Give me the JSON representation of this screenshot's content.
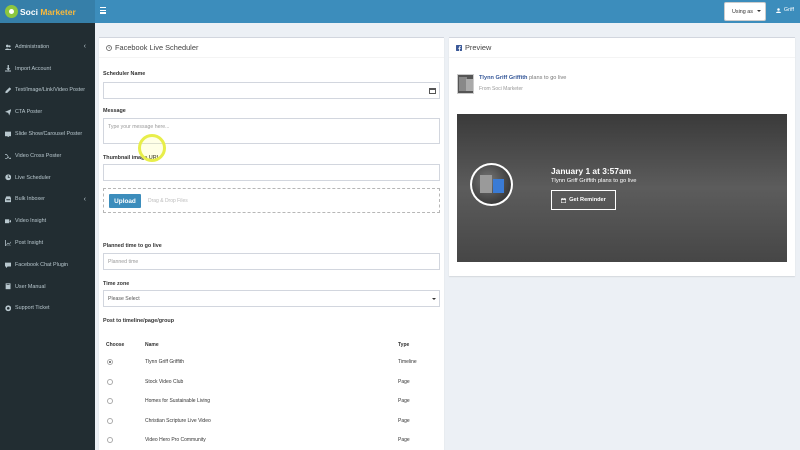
{
  "app": {
    "logo_main": "Soci",
    "logo_accent": "Marketer"
  },
  "header": {
    "using_as_label": "Using as",
    "user_name": "Griff"
  },
  "sidebar": {
    "items": [
      {
        "label": "Administration",
        "icon": "users-icon",
        "has_chevron": true
      },
      {
        "label": "Import Account",
        "icon": "import-icon",
        "has_chevron": false
      },
      {
        "label": "Text/Image/Link/Video Poster",
        "icon": "edit-icon",
        "has_chevron": false
      },
      {
        "label": "CTA Poster",
        "icon": "send-icon",
        "has_chevron": false
      },
      {
        "label": "Slide Show/Carousel Poster",
        "icon": "slideshow-icon",
        "has_chevron": false
      },
      {
        "label": "Video Cross Poster",
        "icon": "shuffle-icon",
        "has_chevron": false
      },
      {
        "label": "Live Scheduler",
        "icon": "clock-icon",
        "has_chevron": false
      },
      {
        "label": "Bulk Inboxer",
        "icon": "inbox-icon",
        "has_chevron": true
      },
      {
        "label": "Video Insight",
        "icon": "video-icon",
        "has_chevron": false
      },
      {
        "label": "Post Insight",
        "icon": "chart-icon",
        "has_chevron": false
      },
      {
        "label": "Facebook Chat Plugin",
        "icon": "chat-icon",
        "has_chevron": false
      },
      {
        "label": "User Manual",
        "icon": "book-icon",
        "has_chevron": false
      },
      {
        "label": "Support Ticket",
        "icon": "support-icon",
        "has_chevron": false
      }
    ],
    "chevron": "‹"
  },
  "scheduler": {
    "title": "Facebook Live Scheduler",
    "name_label": "Scheduler Name",
    "name_value": "",
    "message_label": "Message",
    "message_placeholder": "Type your message here...",
    "thumbnail_label": "Thumbnail image URL",
    "thumbnail_value": "",
    "upload_button": "Upload",
    "upload_hint": "Drag & Drop Files",
    "planned_label": "Planned time to go live",
    "planned_placeholder": "Planned time",
    "timezone_label": "Time zone",
    "timezone_selected": "Please Select",
    "post_to_label": "Post to timeline/page/group",
    "table": {
      "headers": {
        "choose": "Choose",
        "name": "Name",
        "type": "Type"
      },
      "rows": [
        {
          "name": "Tlynn Griff Griffith",
          "type": "Timeline",
          "checked": true
        },
        {
          "name": "Stock Video Club",
          "type": "Page",
          "checked": false
        },
        {
          "name": "Homes for Sustainable Living",
          "type": "Page",
          "checked": false
        },
        {
          "name": "Christian Scripture Live Video",
          "type": "Page",
          "checked": false
        },
        {
          "name": "Video Hero Pro Community",
          "type": "Page",
          "checked": false
        }
      ]
    }
  },
  "preview": {
    "title": "Preview",
    "poster_name": "Tlynn Griff Griffith",
    "poster_action": "plans to go live",
    "via": "From Soci Marketer",
    "live_time": "January 1 at 3:57am",
    "live_sub": "Tlynn Griff Griffith plans to go live",
    "reminder_button": "Get Reminder"
  },
  "colors": {
    "header": "#3c8dbc",
    "logo_bar": "#367fa9",
    "sidebar": "#222d32",
    "sidebar_text": "#b8c7ce",
    "accent_yellow": "#f8b93d",
    "logo_green": "#8cc63f",
    "facebook_blue": "#365899"
  }
}
